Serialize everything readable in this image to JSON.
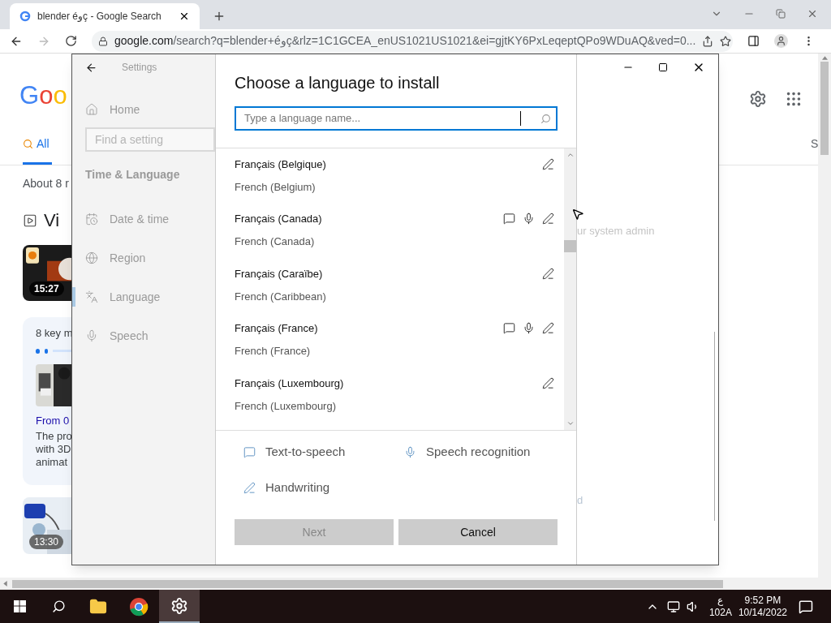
{
  "browser": {
    "tab_title": "blender éوç - Google Search",
    "url_host": "google.com",
    "url_path": "/search?q=blender+éوç&rlz=1C1GCEA_enUS1021US1021&ei=gjtKY6PxLeqeptQPo9WDuAQ&ved=0..."
  },
  "search_page": {
    "logo": "Goo",
    "tabs": [
      {
        "label": "All",
        "selected": true
      }
    ],
    "right_tab": "S",
    "result_stats": "About 8 r",
    "videos_heading": "Vi",
    "video_1": {
      "duration": "15:27"
    },
    "key_moments": {
      "title": "8 key m",
      "link": "From 0",
      "snippet": [
        "The pro",
        "with 3D",
        "animat"
      ]
    },
    "video_2": {
      "duration": "13:30"
    }
  },
  "settings": {
    "title": "Settings",
    "home": "Home",
    "search_placeholder": "Find a setting",
    "section": "Time & Language",
    "nav": [
      {
        "label": "Date & time",
        "selected": false
      },
      {
        "label": "Region",
        "selected": false
      },
      {
        "label": "Language",
        "selected": true
      },
      {
        "label": "Speech",
        "selected": false
      }
    ],
    "background_texts": [
      "ur system admin",
      "d"
    ]
  },
  "dialog": {
    "title": "Choose a language to install",
    "search_placeholder": "Type a language name...",
    "languages": [
      {
        "name": "Français (Belgique)",
        "english": "French (Belgium)",
        "tts": false,
        "speech": false,
        "handwriting": true
      },
      {
        "name": "Français (Canada)",
        "english": "French (Canada)",
        "tts": true,
        "speech": true,
        "handwriting": true
      },
      {
        "name": "Français (Caraïbe)",
        "english": "French (Caribbean)",
        "tts": false,
        "speech": false,
        "handwriting": true
      },
      {
        "name": "Français (France)",
        "english": "French (France)",
        "tts": true,
        "speech": true,
        "handwriting": true
      },
      {
        "name": "Français (Luxembourg)",
        "english": "French (Luxembourg)",
        "tts": false,
        "speech": false,
        "handwriting": true
      }
    ],
    "legend": [
      {
        "kind": "tts",
        "label": "Text-to-speech"
      },
      {
        "kind": "speech",
        "label": "Speech recognition"
      },
      {
        "kind": "handwriting",
        "label": "Handwriting"
      }
    ],
    "buttons": [
      {
        "label": "Next",
        "disabled": true
      },
      {
        "label": "Cancel",
        "disabled": false
      }
    ]
  },
  "taskbar": {
    "apps": [
      {
        "selected": false
      },
      {
        "selected": false
      },
      {
        "selected": true
      }
    ],
    "input_indicator": "ع",
    "layout": "102A",
    "time": "9:52 PM",
    "date": "10/14/2022"
  }
}
